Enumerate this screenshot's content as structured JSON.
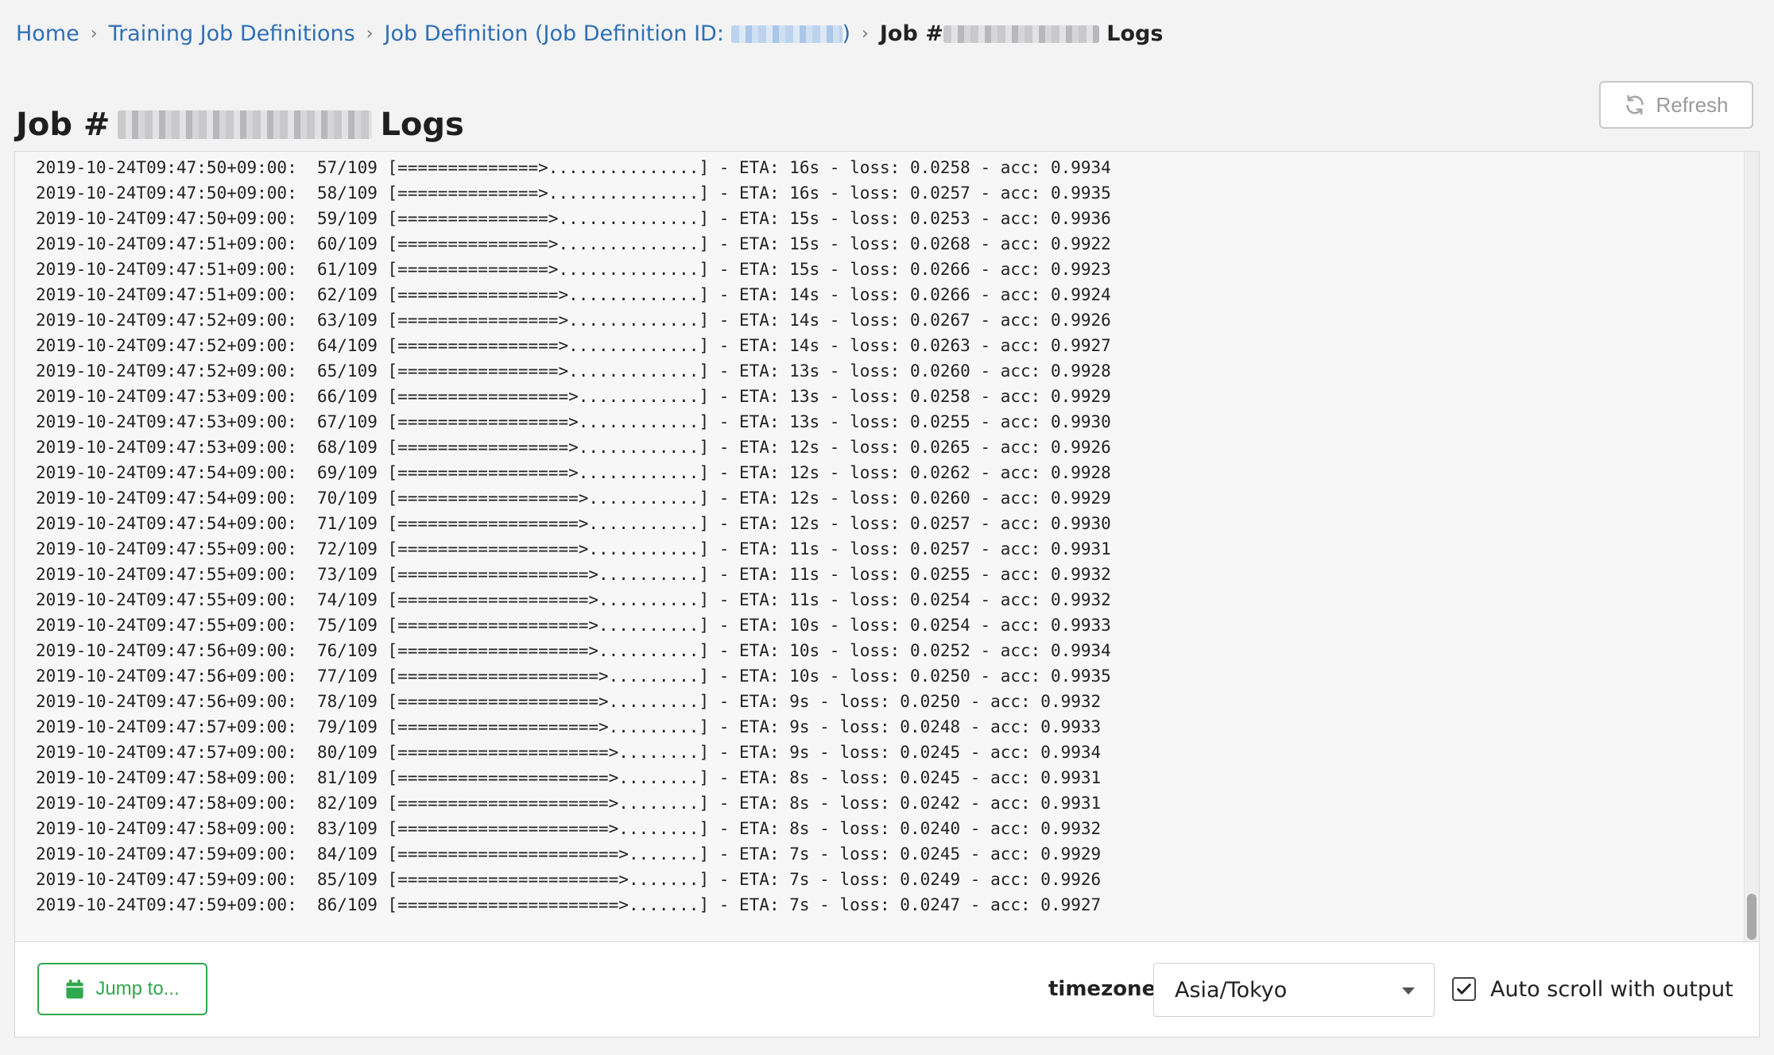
{
  "breadcrumb": {
    "home": "Home",
    "definitions": "Training Job Definitions",
    "definition_prefix": "Job Definition (Job Definition ID: ",
    "definition_suffix": ")",
    "current_prefix": "Job #",
    "current_suffix": "Logs"
  },
  "page_title": {
    "prefix": "Job #",
    "suffix": "Logs"
  },
  "refresh_label": "Refresh",
  "logs": [
    "2019-10-24T09:47:50+09:00:  57/109 [==============>...............] - ETA: 16s - loss: 0.0258 - acc: 0.9934",
    "2019-10-24T09:47:50+09:00:  58/109 [==============>...............] - ETA: 16s - loss: 0.0257 - acc: 0.9935",
    "2019-10-24T09:47:50+09:00:  59/109 [===============>..............] - ETA: 15s - loss: 0.0253 - acc: 0.9936",
    "2019-10-24T09:47:51+09:00:  60/109 [===============>..............] - ETA: 15s - loss: 0.0268 - acc: 0.9922",
    "2019-10-24T09:47:51+09:00:  61/109 [===============>..............] - ETA: 15s - loss: 0.0266 - acc: 0.9923",
    "2019-10-24T09:47:51+09:00:  62/109 [================>.............] - ETA: 14s - loss: 0.0266 - acc: 0.9924",
    "2019-10-24T09:47:52+09:00:  63/109 [================>.............] - ETA: 14s - loss: 0.0267 - acc: 0.9926",
    "2019-10-24T09:47:52+09:00:  64/109 [================>.............] - ETA: 14s - loss: 0.0263 - acc: 0.9927",
    "2019-10-24T09:47:52+09:00:  65/109 [================>.............] - ETA: 13s - loss: 0.0260 - acc: 0.9928",
    "2019-10-24T09:47:53+09:00:  66/109 [=================>............] - ETA: 13s - loss: 0.0258 - acc: 0.9929",
    "2019-10-24T09:47:53+09:00:  67/109 [=================>............] - ETA: 13s - loss: 0.0255 - acc: 0.9930",
    "2019-10-24T09:47:53+09:00:  68/109 [=================>............] - ETA: 12s - loss: 0.0265 - acc: 0.9926",
    "2019-10-24T09:47:54+09:00:  69/109 [=================>............] - ETA: 12s - loss: 0.0262 - acc: 0.9928",
    "2019-10-24T09:47:54+09:00:  70/109 [==================>...........] - ETA: 12s - loss: 0.0260 - acc: 0.9929",
    "2019-10-24T09:47:54+09:00:  71/109 [==================>...........] - ETA: 12s - loss: 0.0257 - acc: 0.9930",
    "2019-10-24T09:47:55+09:00:  72/109 [==================>...........] - ETA: 11s - loss: 0.0257 - acc: 0.9931",
    "2019-10-24T09:47:55+09:00:  73/109 [===================>..........] - ETA: 11s - loss: 0.0255 - acc: 0.9932",
    "2019-10-24T09:47:55+09:00:  74/109 [===================>..........] - ETA: 11s - loss: 0.0254 - acc: 0.9932",
    "2019-10-24T09:47:55+09:00:  75/109 [===================>..........] - ETA: 10s - loss: 0.0254 - acc: 0.9933",
    "2019-10-24T09:47:56+09:00:  76/109 [===================>..........] - ETA: 10s - loss: 0.0252 - acc: 0.9934",
    "2019-10-24T09:47:56+09:00:  77/109 [====================>.........] - ETA: 10s - loss: 0.0250 - acc: 0.9935",
    "2019-10-24T09:47:56+09:00:  78/109 [====================>.........] - ETA: 9s - loss: 0.0250 - acc: 0.9932",
    "2019-10-24T09:47:57+09:00:  79/109 [====================>.........] - ETA: 9s - loss: 0.0248 - acc: 0.9933",
    "2019-10-24T09:47:57+09:00:  80/109 [=====================>........] - ETA: 9s - loss: 0.0245 - acc: 0.9934",
    "2019-10-24T09:47:58+09:00:  81/109 [=====================>........] - ETA: 8s - loss: 0.0245 - acc: 0.9931",
    "2019-10-24T09:47:58+09:00:  82/109 [=====================>........] - ETA: 8s - loss: 0.0242 - acc: 0.9931",
    "2019-10-24T09:47:58+09:00:  83/109 [=====================>........] - ETA: 8s - loss: 0.0240 - acc: 0.9932",
    "2019-10-24T09:47:59+09:00:  84/109 [======================>.......] - ETA: 7s - loss: 0.0245 - acc: 0.9929",
    "2019-10-24T09:47:59+09:00:  85/109 [======================>.......] - ETA: 7s - loss: 0.0249 - acc: 0.9926",
    "2019-10-24T09:47:59+09:00:  86/109 [======================>.......] - ETA: 7s - loss: 0.0247 - acc: 0.9927"
  ],
  "footer": {
    "jump_label": "Jump to...",
    "timezone_label": "timezone",
    "timezone_value": "Asia/Tokyo",
    "autoscroll_label": "Auto scroll with output",
    "autoscroll_checked": true
  },
  "colors": {
    "link": "#2f6fb5",
    "accent_green": "#2fa84f",
    "log_background": "#f7f7f8"
  },
  "icons": {
    "refresh": "refresh-icon",
    "jump": "calendar-icon",
    "select": "caret-down-icon",
    "check": "check-icon"
  }
}
